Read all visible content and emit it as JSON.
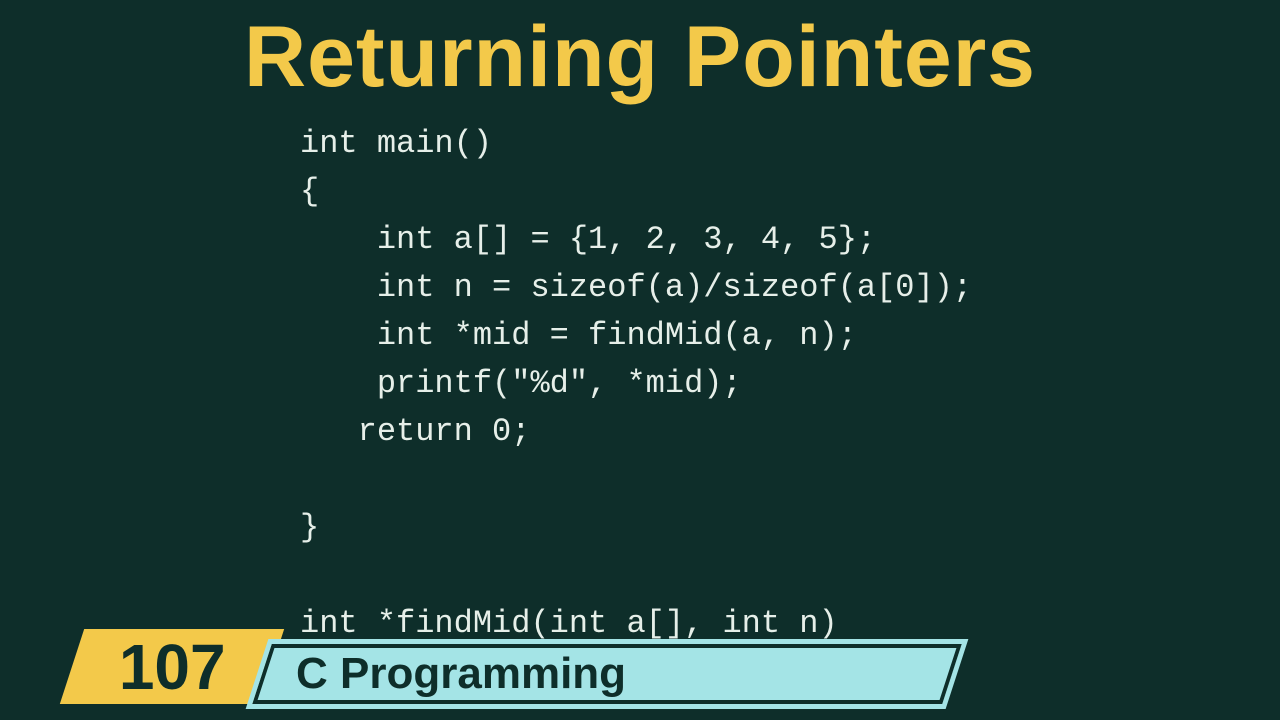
{
  "title": "Returning Pointers",
  "code": "int main()\n{\n    int a[] = {1, 2, 3, 4, 5};\n    int n = sizeof(a)/sizeof(a[0]);\n    int *mid = findMid(a, n);\n    printf(\"%d\", *mid);\n   return 0;\n\n}\n\nint *findMid(int a[], int n)\n{",
  "badge": {
    "number": "107",
    "subject": "C Programming"
  }
}
